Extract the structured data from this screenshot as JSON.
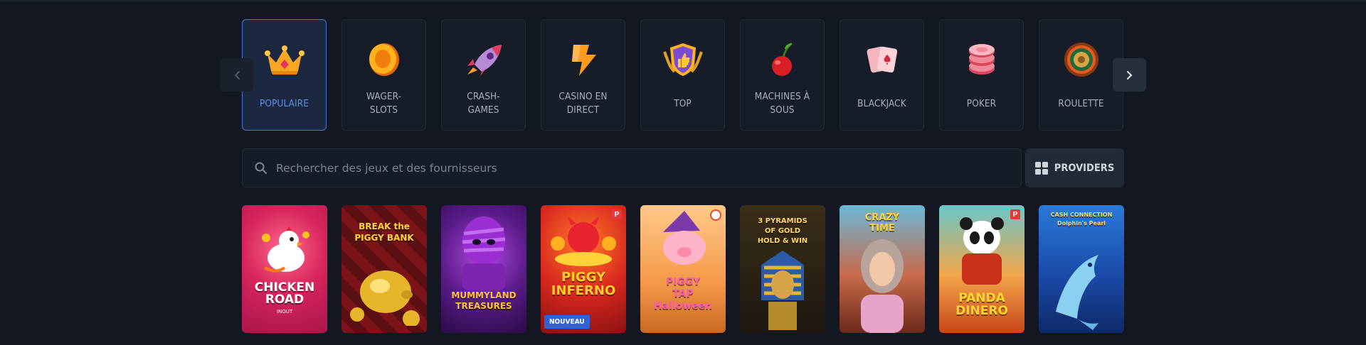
{
  "categories": [
    {
      "label": "POPULAIRE",
      "icon": "crown-icon",
      "active": true
    },
    {
      "label": "WAGER-\nSLOTS",
      "icon": "coin-icon",
      "active": false
    },
    {
      "label": "CRASH-\nGAMES",
      "icon": "rocket-icon",
      "active": false
    },
    {
      "label": "CASINO EN\nDIRECT",
      "icon": "lightning-icon",
      "active": false
    },
    {
      "label": "TOP",
      "icon": "thumbs-up-shield-icon",
      "active": false
    },
    {
      "label": "MACHINES À\nSOUS",
      "icon": "cherry-icon",
      "active": false
    },
    {
      "label": "BLACKJACK",
      "icon": "playing-cards-icon",
      "active": false
    },
    {
      "label": "POKER",
      "icon": "poker-chips-icon",
      "active": false
    },
    {
      "label": "ROULETTE",
      "icon": "roulette-wheel-icon",
      "active": false
    }
  ],
  "search": {
    "placeholder": "Rechercher des jeux et des fournisseurs"
  },
  "providers": {
    "label": "PROVIDERS"
  },
  "games": [
    {
      "title": "CHICKEN\nROAD",
      "sub": "INOUT",
      "bg": "#c4205e"
    },
    {
      "title": "BREAK the\nPIGGY BANK",
      "bg": "#7a1d1f"
    },
    {
      "title": "MUMMYLAND\nTREASURES",
      "bg": "#4a1a6b"
    },
    {
      "title": "PIGGY\nINFERNO",
      "bg": "#c2261a",
      "badge": "NOUVEAU",
      "corner": "P"
    },
    {
      "title": "PIGGY\nTAP\nHalloween",
      "bg": "#e9a65c"
    },
    {
      "title": "3 PYRAMIDS\nOF GOLD\nHOLD & WIN",
      "bg": "#2a2216"
    },
    {
      "title": "CRAZY\nTIME",
      "bg": "#b55a45"
    },
    {
      "title": "PANDA\nDINERO",
      "bg": "#d96e2a",
      "corner": "P"
    },
    {
      "title": "CASH CONNECTION\nDolphin's Pearl",
      "bg": "#1b4fa6"
    }
  ],
  "colors": {
    "accent": "#4a78c8",
    "background": "#121722"
  }
}
